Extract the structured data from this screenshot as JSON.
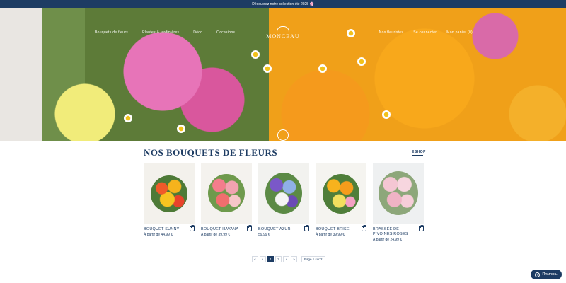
{
  "topbar": {
    "message": "Découvrez notre collection été 2025 🌸"
  },
  "nav": {
    "left": [
      "Bouquets de fleurs",
      "Plantes & jardinières",
      "Déco",
      "Occasions"
    ],
    "right": [
      "Nos fleuristes",
      "Se connecter",
      "Mon panier (0)"
    ]
  },
  "logo": {
    "text": "MONCEAU"
  },
  "section": {
    "title": "NOS BOUQUETS DE FLEURS",
    "eshop": "ESHOP"
  },
  "products": [
    {
      "name": "BOUQUET SUNNY",
      "price": "À partir de 44,99 €"
    },
    {
      "name": "BOUQUET HAVANA",
      "price": "À partir de 39,99 €"
    },
    {
      "name": "BOUQUET AZUR",
      "price": "59,99 €"
    },
    {
      "name": "BOUQUET BRISE",
      "price": "À partir de 39,99 €"
    },
    {
      "name": "BRASSÉE DE PIVOINES ROSES",
      "price": "À partir de 24,99 €"
    }
  ],
  "pagination": {
    "first": "«",
    "prev": "‹",
    "pages": [
      "1",
      "2"
    ],
    "next": "›",
    "last": "»",
    "info": "Page 1 sur 2"
  },
  "help": {
    "label": "Помощь"
  },
  "colors": {
    "navy": "#1d3c63"
  }
}
